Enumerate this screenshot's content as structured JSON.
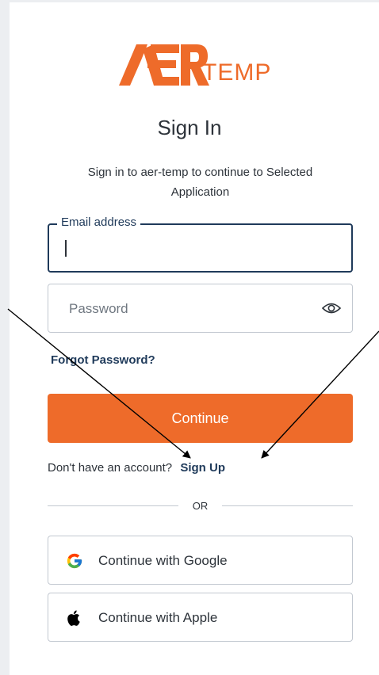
{
  "logo": {
    "mark": "AER",
    "text": "TEMP"
  },
  "heading": {
    "title": "Sign In",
    "subtitle": "Sign in to aer-temp to continue to Selected Application"
  },
  "form": {
    "email_label": "Email address",
    "email_value": "",
    "password_placeholder": "Password",
    "forgot_label": "Forgot Password?",
    "continue_label": "Continue"
  },
  "signup": {
    "prompt": "Don't have an account?",
    "link_label": "Sign Up"
  },
  "divider": {
    "label": "OR"
  },
  "social": {
    "google_label": "Continue with Google",
    "apple_label": "Continue with Apple"
  },
  "icons": {
    "password_toggle": "eye-icon",
    "google": "google-icon",
    "apple": "apple-icon"
  },
  "colors": {
    "brand_orange": "#ee6b2a",
    "navy": "#1f3a5a",
    "text": "#2d333a",
    "border": "#c2c8d0"
  }
}
